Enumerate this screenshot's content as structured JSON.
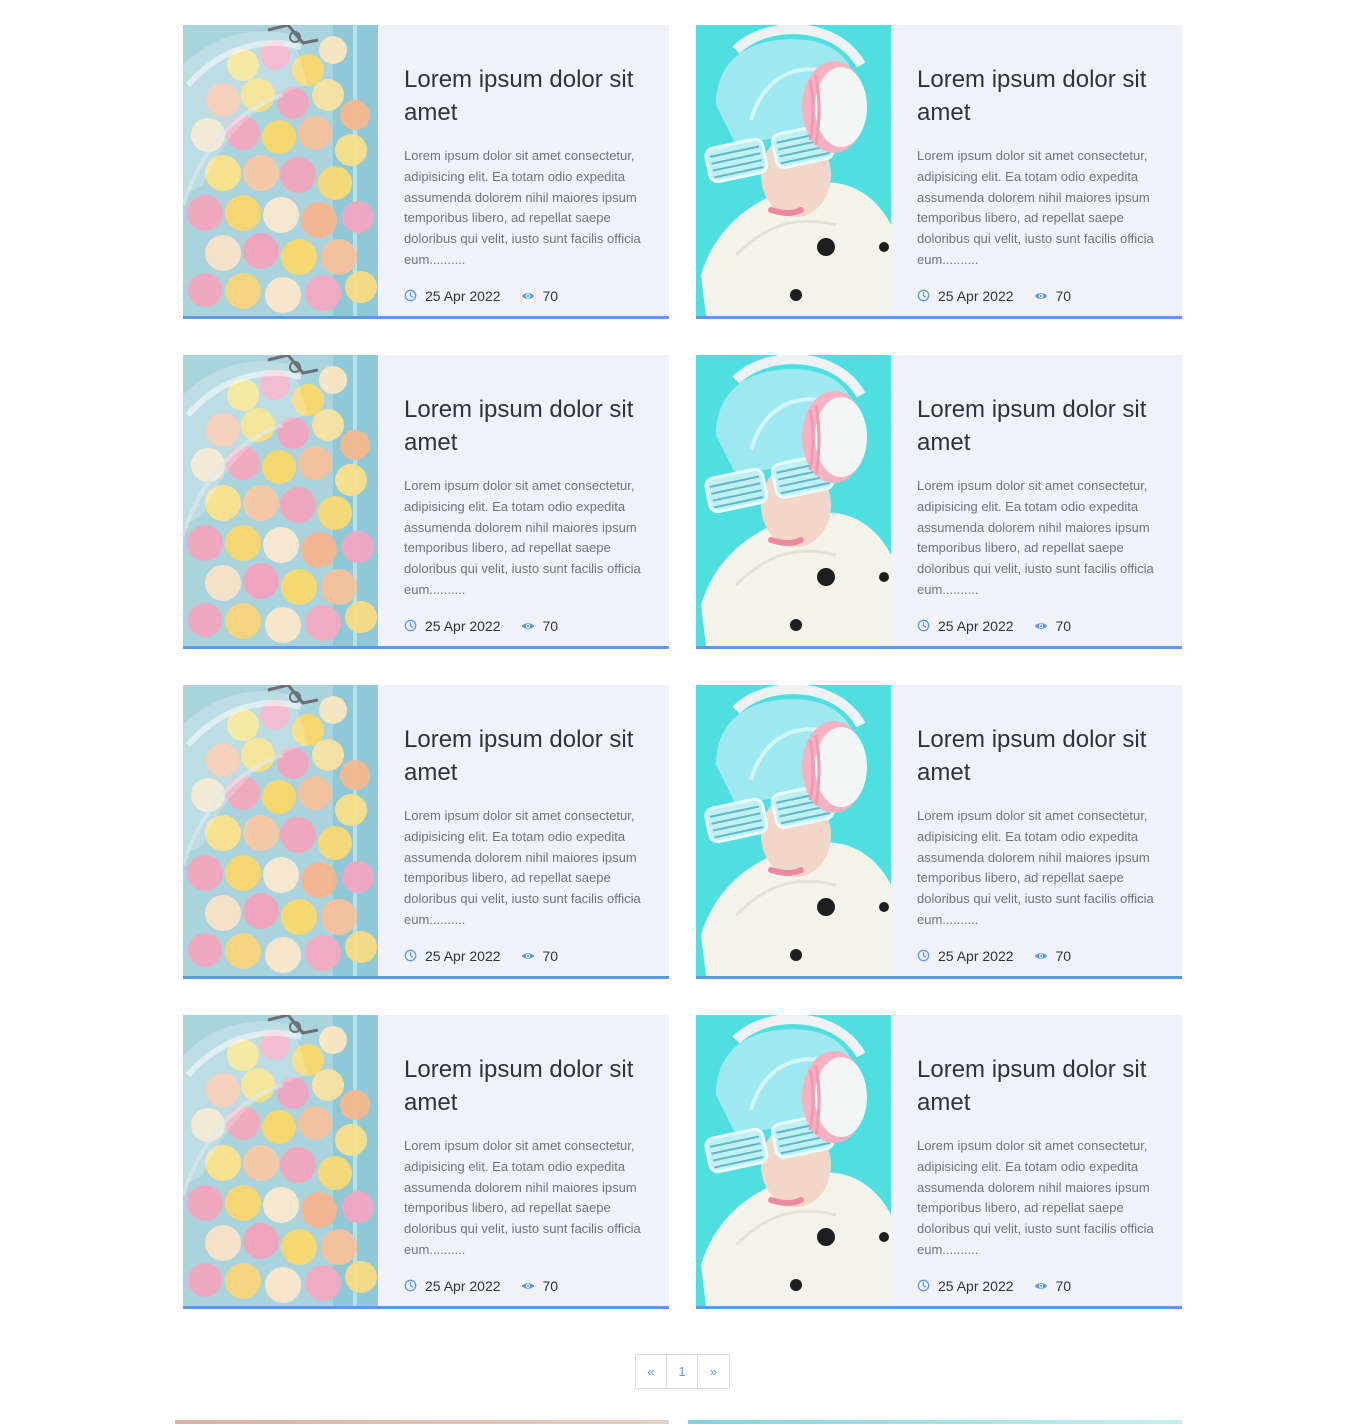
{
  "posts": [
    {
      "image": "candy-jar",
      "title": "Lorem ipsum dolor sit amet",
      "excerpt": "Lorem ipsum dolor sit amet consectetur, adipisicing elit. Ea totam odio expedita assumenda dolorem nihil maiores ipsum temporibus libero, ad repellat saepe doloribus qui velit, iusto sunt facilis officia eum..........",
      "date": "25 Apr 2022",
      "views": "70"
    },
    {
      "image": "headphones-girl",
      "title": "Lorem ipsum dolor sit amet",
      "excerpt": "Lorem ipsum dolor sit amet consectetur, adipisicing elit. Ea totam odio expedita assumenda dolorem nihil maiores ipsum temporibus libero, ad repellat saepe doloribus qui velit, iusto sunt facilis officia eum..........",
      "date": "25 Apr 2022",
      "views": "70"
    },
    {
      "image": "candy-jar",
      "title": "Lorem ipsum dolor sit amet",
      "excerpt": "Lorem ipsum dolor sit amet consectetur, adipisicing elit. Ea totam odio expedita assumenda dolorem nihil maiores ipsum temporibus libero, ad repellat saepe doloribus qui velit, iusto sunt facilis officia eum..........",
      "date": "25 Apr 2022",
      "views": "70"
    },
    {
      "image": "headphones-girl",
      "title": "Lorem ipsum dolor sit amet",
      "excerpt": "Lorem ipsum dolor sit amet consectetur, adipisicing elit. Ea totam odio expedita assumenda dolorem nihil maiores ipsum temporibus libero, ad repellat saepe doloribus qui velit, iusto sunt facilis officia eum..........",
      "date": "25 Apr 2022",
      "views": "70"
    },
    {
      "image": "candy-jar",
      "title": "Lorem ipsum dolor sit amet",
      "excerpt": "Lorem ipsum dolor sit amet consectetur, adipisicing elit. Ea totam odio expedita assumenda dolorem nihil maiores ipsum temporibus libero, ad repellat saepe doloribus qui velit, iusto sunt facilis officia eum..........",
      "date": "25 Apr 2022",
      "views": "70"
    },
    {
      "image": "headphones-girl",
      "title": "Lorem ipsum dolor sit amet",
      "excerpt": "Lorem ipsum dolor sit amet consectetur, adipisicing elit. Ea totam odio expedita assumenda dolorem nihil maiores ipsum temporibus libero, ad repellat saepe doloribus qui velit, iusto sunt facilis officia eum..........",
      "date": "25 Apr 2022",
      "views": "70"
    },
    {
      "image": "candy-jar",
      "title": "Lorem ipsum dolor sit amet",
      "excerpt": "Lorem ipsum dolor sit amet consectetur, adipisicing elit. Ea totam odio expedita assumenda dolorem nihil maiores ipsum temporibus libero, ad repellat saepe doloribus qui velit, iusto sunt facilis officia eum..........",
      "date": "25 Apr 2022",
      "views": "70"
    },
    {
      "image": "headphones-girl",
      "title": "Lorem ipsum dolor sit amet",
      "excerpt": "Lorem ipsum dolor sit amet consectetur, adipisicing elit. Ea totam odio expedita assumenda dolorem nihil maiores ipsum temporibus libero, ad repellat saepe doloribus qui velit, iusto sunt facilis officia eum..........",
      "date": "25 Apr 2022",
      "views": "70"
    }
  ],
  "icons": {
    "date": "clock-icon",
    "views": "eye-icon"
  },
  "colors": {
    "accent": "#5b9be6",
    "card_bg": "#f1f2f7",
    "title": "#2f3438",
    "excerpt": "#6f7377"
  },
  "pagination": {
    "prev": "«",
    "current": "1",
    "next": "»"
  }
}
